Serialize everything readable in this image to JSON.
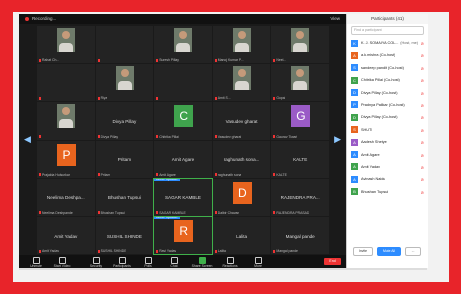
{
  "colors": {
    "frame": "#e8242a",
    "accent": "#2d8cff",
    "share_green": "#3fb04a",
    "end_red": "#e33333"
  },
  "topbar": {
    "recording": "Recording...",
    "view": "View"
  },
  "tiles": [
    {
      "name": "Rahat Ch...",
      "kind": "photo"
    },
    {
      "name": "",
      "kind": "empty"
    },
    {
      "name": "Suresh Pillay",
      "kind": "photo"
    },
    {
      "name": "Manoj Kumar P...",
      "kind": "photo"
    },
    {
      "name": "Neel...",
      "kind": "photo"
    },
    {
      "name": "",
      "kind": "empty"
    },
    {
      "name": "Riya",
      "kind": "photo"
    },
    {
      "name": "",
      "kind": "empty"
    },
    {
      "name": "Amit S...",
      "kind": "photo"
    },
    {
      "name": "Gopal",
      "kind": "photo"
    },
    {
      "name": "",
      "kind": "photo"
    },
    {
      "name": "Divya Pillay",
      "kind": "text",
      "foot": "Divya Pillay"
    },
    {
      "name": "C",
      "kind": "avatar",
      "color": "#3fa34d",
      "foot": "Chitrika Pillai"
    },
    {
      "name": "Vasudev gharat",
      "kind": "text",
      "foot": "Vasudev gharat"
    },
    {
      "name": "G",
      "kind": "avatar",
      "color": "#9a5bc6",
      "foot": "Gaurav Tiwari"
    },
    {
      "name": "P",
      "kind": "avatar",
      "color": "#e8641e",
      "foot": "Prajakta Hulsurkar"
    },
    {
      "name": "Pritam",
      "kind": "text",
      "foot": "Pritam"
    },
    {
      "name": "Amit Agare",
      "kind": "text",
      "foot": "Amit Agare"
    },
    {
      "name": "raghunath sona...",
      "kind": "text",
      "foot": "raghunath sona"
    },
    {
      "name": "KALTE",
      "kind": "text",
      "foot": "KALTE"
    },
    {
      "name": "Neelima Deshpa...",
      "kind": "text",
      "foot": "Neelima Deshpande"
    },
    {
      "name": "Bhushan Tupsui",
      "kind": "text",
      "foot": "Bhushan Tupsui"
    },
    {
      "name": "SAGAR KAMBLE",
      "kind": "text",
      "foot": "SAGAR KAMBLE",
      "badge": "Active Speaker"
    },
    {
      "name": "D",
      "kind": "avatar",
      "color": "#e8641e",
      "foot": "Dalbir Chavan"
    },
    {
      "name": "RAJENDRA PRA...",
      "kind": "text",
      "foot": "RAJENDRA PRASAD"
    },
    {
      "name": "Amit Yadav",
      "kind": "text",
      "foot": "Amit Yadav"
    },
    {
      "name": "SUSHIL SHINDE",
      "kind": "text",
      "foot": "SUSHIL SHINDE"
    },
    {
      "name": "R",
      "kind": "avatar",
      "color": "#e8641e",
      "foot": "Ravi Yadav",
      "badge": "Active Speaker"
    },
    {
      "name": "Lalita",
      "kind": "text",
      "foot": "Lalita"
    },
    {
      "name": "Mangal pande",
      "kind": "text",
      "foot": "Mangal pande"
    }
  ],
  "toolbar": [
    {
      "label": "Unmute"
    },
    {
      "label": "Start Video"
    },
    {
      "label": "Security"
    },
    {
      "label": "Participants"
    },
    {
      "label": "Polls"
    },
    {
      "label": "Chat"
    },
    {
      "label": "Share Screen"
    },
    {
      "label": "Reactions"
    },
    {
      "label": "More"
    }
  ],
  "end_label": "End",
  "panel": {
    "title": "Participants (41)",
    "search_placeholder": "Find a participant",
    "rows": [
      {
        "initial": "K",
        "name": "K. J. SOMAIYA COL...",
        "info": "(Host, me)",
        "color": "#2d8cff"
      },
      {
        "initial": "A",
        "name": "a.k.mishra (Co-host)",
        "info": "",
        "color": "#e8641e"
      },
      {
        "initial": "S",
        "name": "sandeep pandit (Co-host)",
        "info": "",
        "color": "#2d8cff"
      },
      {
        "initial": "C",
        "name": "Chitrika Pillai (Co-host)",
        "info": "",
        "color": "#3fa34d"
      },
      {
        "initial": "D",
        "name": "Divya Pillay (Co-host)",
        "info": "",
        "color": "#2d8cff"
      },
      {
        "initial": "P",
        "name": "Pradnya Pailkar (Co-host)",
        "info": "",
        "color": "#2d8cff"
      },
      {
        "initial": "D",
        "name": "Divya Pillay (Co-host)",
        "info": "",
        "color": "#3fa34d"
      },
      {
        "initial": "S",
        "name": "SHUTI",
        "info": "",
        "color": "#e8641e"
      },
      {
        "initial": "A",
        "name": "Aadesh Shetye",
        "info": "",
        "color": "#9a5bc6"
      },
      {
        "initial": "A",
        "name": "Amit Agare",
        "info": "",
        "color": "#2d8cff"
      },
      {
        "initial": "A",
        "name": "Amit Yadav",
        "info": "",
        "color": "#3fa34d"
      },
      {
        "initial": "A",
        "name": "Avinash Naidu",
        "info": "",
        "color": "#2d8cff"
      },
      {
        "initial": "B",
        "name": "Bhushan Tupsui",
        "info": "",
        "color": "#3fa34d"
      }
    ],
    "invite_label": "Invite",
    "mute_all_label": "Mute All",
    "more_label": "..."
  }
}
